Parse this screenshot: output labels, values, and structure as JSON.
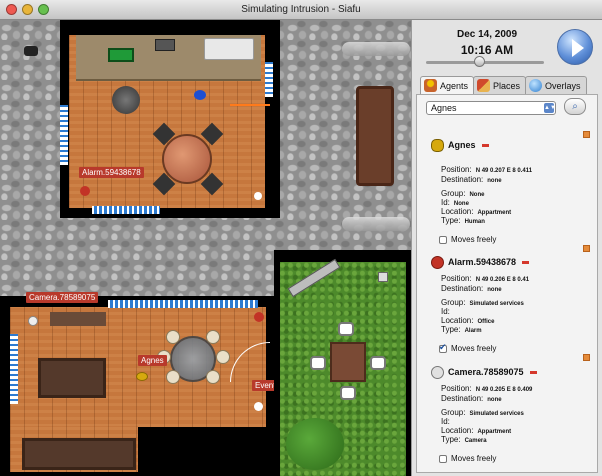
{
  "window": {
    "title": "Simulating Intrusion - Siafu"
  },
  "clock": {
    "date": "Dec 14, 2009",
    "time": "10:16 AM",
    "speed_level": 0.45
  },
  "tabs": [
    {
      "label": "Agents",
      "icon": "agent-icon",
      "active": true
    },
    {
      "label": "Places",
      "icon": "house-icon",
      "active": false
    },
    {
      "label": "Overlays",
      "icon": "globe-icon",
      "active": false
    }
  ],
  "agent_select": {
    "selected": "Agnes"
  },
  "field_labels": {
    "position": "Position:",
    "destination": "Destination:",
    "group": "Group:",
    "id": "Id:",
    "location": "Location:",
    "type": "Type:",
    "moves_freely": "Moves freely"
  },
  "entities": [
    {
      "name": "Agnes",
      "position": "N 49 0.207 E 8 0.411",
      "destination": "none",
      "group": "None",
      "id": "None",
      "location": "Appartment",
      "type": "Human",
      "moves_freely": false,
      "color": "#d6a90e"
    },
    {
      "name": "Alarm.59438678",
      "position": "N 49 0.206 E 8 0.41",
      "destination": "none",
      "group": "Simulated services",
      "id": "",
      "location": "Office",
      "type": "Alarm",
      "moves_freely": true,
      "color": "#c23326"
    },
    {
      "name": "Camera.78589075",
      "position": "N 49 0.205 E 8 0.409",
      "destination": "none",
      "group": "Simulated services",
      "id": "",
      "location": "Appartment",
      "type": "Camera",
      "moves_freely": false,
      "color": "#bdbdbd"
    }
  ],
  "map_labels": {
    "alarm": "Alarm.59438678",
    "camera": "Camera.78589075",
    "agnes": "Agnes",
    "event": "Event motion sent"
  },
  "colors": {
    "floor": "#c6773d",
    "grass": "#4d8a2b",
    "label_bg": "#b8392b",
    "play_button": "#5f8fd8"
  }
}
